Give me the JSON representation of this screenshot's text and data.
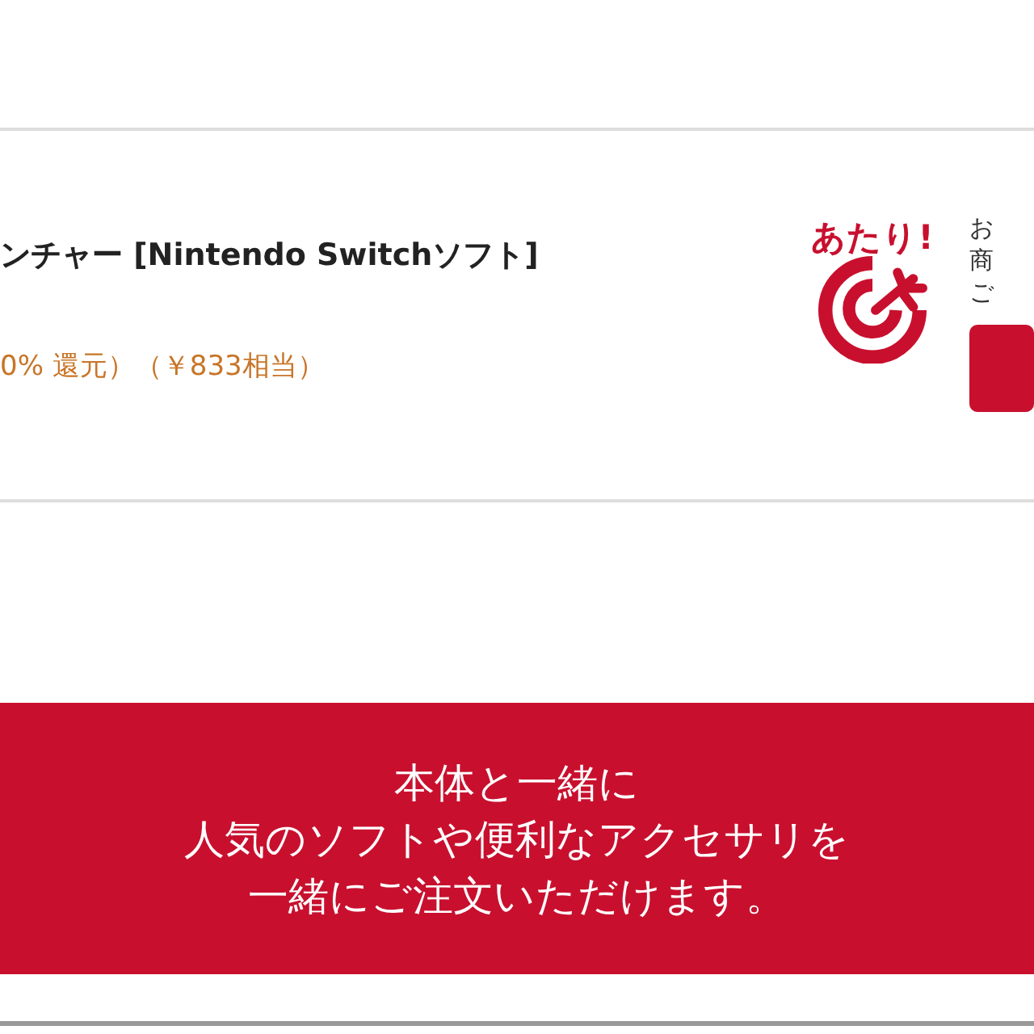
{
  "product": {
    "title": "ンチャー [Nintendo Switchソフト]",
    "points": "0% 還元）（￥833相当）",
    "badge": "あたり!",
    "side_lines": [
      "お",
      "商",
      "ご"
    ]
  },
  "banner": {
    "lines": [
      "本体と一緒に",
      "人気のソフトや便利なアクセサリを",
      "一緒にご注文いただけます。"
    ]
  }
}
